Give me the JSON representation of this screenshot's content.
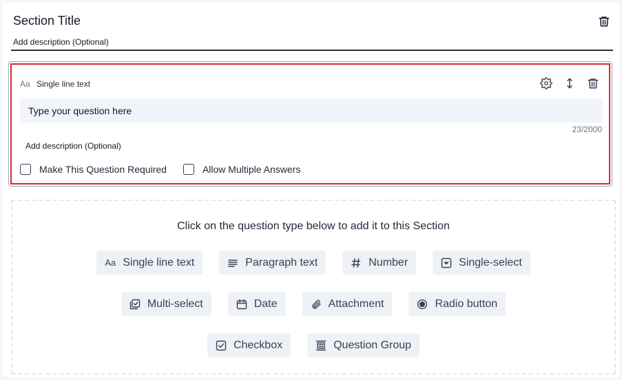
{
  "section": {
    "title": "Section Title",
    "description_placeholder": "Add description (Optional)"
  },
  "question": {
    "type_icon_text": "Aa",
    "type_label": "Single line text",
    "input_value": "Type your question here",
    "char_counter": "23/2000",
    "description_placeholder": "Add description (Optional)",
    "options": [
      {
        "label": "Make This Question Required",
        "checked": false
      },
      {
        "label": "Allow Multiple Answers",
        "checked": false
      }
    ],
    "actions": [
      "gear-icon",
      "move-vertical-icon",
      "trash-icon"
    ]
  },
  "picker": {
    "title": "Click on the question type below to add it to this Section",
    "types": [
      {
        "label": "Single line text",
        "icon": "text-aa-icon",
        "icon_text": "Aa"
      },
      {
        "label": "Paragraph text",
        "icon": "paragraph-icon"
      },
      {
        "label": "Number",
        "icon": "hash-icon",
        "icon_text": "#"
      },
      {
        "label": "Single-select",
        "icon": "dropdown-icon"
      },
      {
        "label": "Multi-select",
        "icon": "multi-select-icon"
      },
      {
        "label": "Date",
        "icon": "calendar-icon"
      },
      {
        "label": "Attachment",
        "icon": "paperclip-icon"
      },
      {
        "label": "Radio button",
        "icon": "radio-icon"
      },
      {
        "label": "Checkbox",
        "icon": "checkbox-icon"
      },
      {
        "label": "Question Group",
        "icon": "question-group-icon"
      }
    ]
  },
  "colors": {
    "highlight_border": "#d62828",
    "chip_background": "#eef2f7",
    "input_background": "#f1f5fb"
  }
}
